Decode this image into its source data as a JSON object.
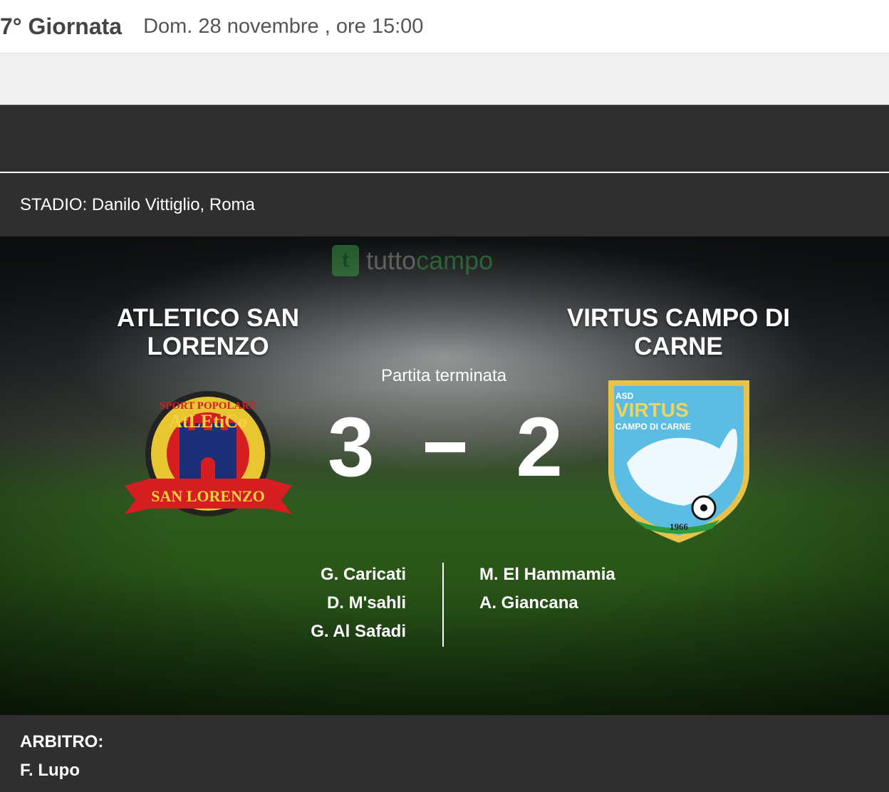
{
  "header": {
    "round": "7° Giornata",
    "date": "Dom. 28 novembre , ore 15:00"
  },
  "stadium": {
    "text": "STADIO: Danilo Vittiglio, Roma"
  },
  "match": {
    "home_team": "ATLETICO SAN LORENZO",
    "away_team": "VIRTUS CAMPO DI CARNE",
    "status": "Partita terminata",
    "home_score": "3",
    "away_score": "2",
    "home_scorers": [
      "G. Caricati",
      "D. M'sahli",
      "G. Al Safadi"
    ],
    "away_scorers": [
      "M. El Hammamia",
      "A. Giancana"
    ]
  },
  "watermark": {
    "letter": "t",
    "text_a": "tutto",
    "text_b": "campo"
  },
  "home_logo": {
    "top": "SPORT POPOLARE",
    "mid": "AtLEtiCo",
    "banner": "SAN LORENZO"
  },
  "away_logo": {
    "asd": "ASD",
    "name": "VIRTUS",
    "sub": "CAMPO DI CARNE",
    "year": "1966"
  },
  "referee": {
    "label": "ARBITRO:",
    "name": "F. Lupo"
  },
  "colors": {
    "dark": "#2f2f2f",
    "brand_green": "#3cb04a",
    "away_blue": "#5bbde4",
    "away_gold": "#e9c24a",
    "home_red": "#d51d22"
  }
}
